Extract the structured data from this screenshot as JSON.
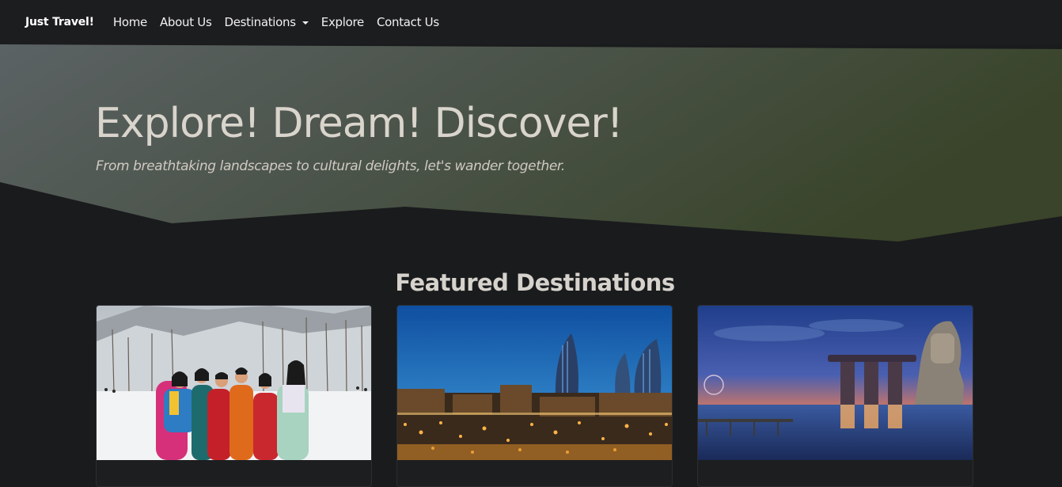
{
  "navbar": {
    "brand": "Just Travel!",
    "links": [
      {
        "label": "Home"
      },
      {
        "label": "About Us"
      },
      {
        "label": "Destinations",
        "dropdown": true
      },
      {
        "label": "Explore"
      },
      {
        "label": "Contact Us"
      }
    ]
  },
  "hero": {
    "title": "Explore! Dream! Discover!",
    "subtitle": "From breathtaking landscapes to cultural delights, let's wander together."
  },
  "featured": {
    "title": "Featured Destinations",
    "cards": [
      {
        "image": "snow-group-photo"
      },
      {
        "image": "baku-flame-towers-night"
      },
      {
        "image": "singapore-marina-bay-sunset"
      }
    ]
  },
  "colors": {
    "background": "#1a1b1d",
    "navbar": "#1c1d1f",
    "hero_gradient_start": "#5b6264",
    "hero_gradient_end": "#39442a"
  }
}
